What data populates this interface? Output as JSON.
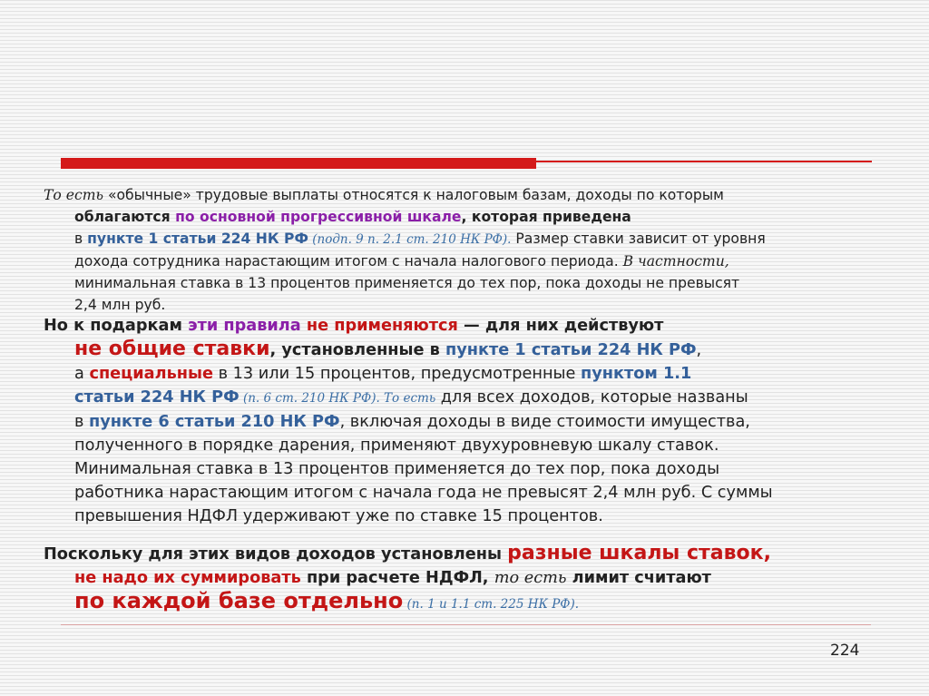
{
  "slide": {
    "page_number": "224",
    "p1": {
      "l1a": "То есть",
      "l1b": " «обычные» трудовые выплаты относятся к налоговым базам, доходы по которым",
      "l2a": "облагаются ",
      "l2b": "по основной прогрессивной шкале",
      "l2c": ", которая приведена",
      "l3a": "в ",
      "l3b": "пункте 1 статьи 224 НК РФ",
      "l3c": " (подп. 9 п. 2.1 ст. 210 НК РФ).",
      "l3d": " Размер ставки зависит от уровня",
      "l4a": "дохода сотрудника нарастающим итогом с начала налогового периода. ",
      "l4b": "В частности,",
      "l5": "минимальная ставка в 13 процентов применяется до тех пор, пока доходы не превысят",
      "l6": "2,4 млн руб."
    },
    "p2": {
      "l1a": "Но к подаркам ",
      "l1b": "эти правила",
      "l1c": " ",
      "l1d": "не применяются",
      "l1e": " — для них действуют",
      "l2a": "не общие ставки",
      "l2b": ", установленные в ",
      "l2c": "пункте 1 статьи 224 НК РФ",
      "l2d": ",",
      "l3a": "а ",
      "l3b": "специальные",
      "l3c": " в 13 или 15 процентов, предусмотренные ",
      "l3d": "пунктом 1.1",
      "l4a": "статьи 224 НК РФ",
      "l4b": " (п. 6 ст. 210 НК РФ). То есть",
      "l4c": " для всех доходов, которые названы",
      "l5a": "в ",
      "l5b": "пункте 6 статьи 210 НК РФ",
      "l5c": ", включая доходы в виде стоимости имущества,",
      "l6": "полученного в порядке дарения, применяют двухуровневую шкалу ставок.",
      "l7": "Минимальная ставка в 13 процентов применяется до тех пор, пока доходы",
      "l8": "работника нарастающим итогом с начала года не превысят 2,4 млн руб. С суммы",
      "l9": "превышения НДФЛ удерживают уже по ставке 15 процентов."
    },
    "p3": {
      "l1a": "Поскольку для этих видов доходов установлены ",
      "l1b": "разные шкалы ставок,",
      "l2a": "не надо их суммировать",
      "l2b": " при расчете НДФЛ, ",
      "l2c": "то есть",
      "l2d": " лимит считают",
      "l3a": "по каждой базе отдельно",
      "l3b": " (п. 1 и 1.1 ст. 225 НК РФ)."
    }
  },
  "colors": {
    "accent_red": "#d41a1a",
    "text_red": "#c41616",
    "purple": "#8b1fa8",
    "blue": "#34609a"
  }
}
